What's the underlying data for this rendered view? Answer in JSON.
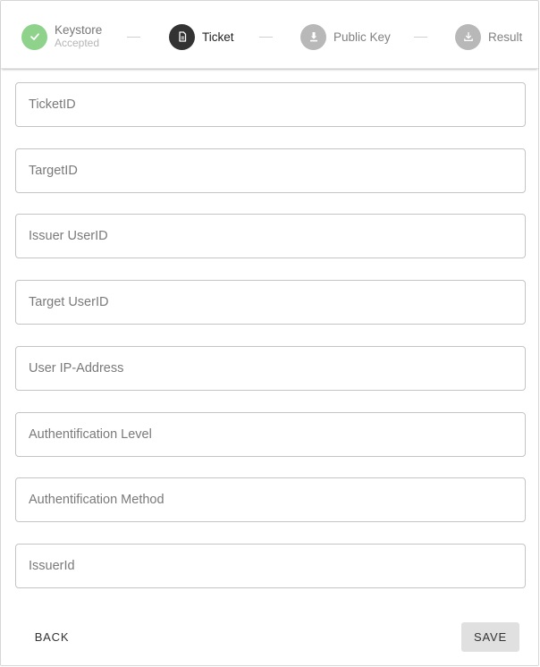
{
  "stepper": {
    "steps": [
      {
        "label": "Keystore",
        "sublabel": "Accepted",
        "icon": "check-icon",
        "state": "completed",
        "color": "#8ed28b"
      },
      {
        "label": "Ticket",
        "icon": "document-icon",
        "state": "active",
        "color": "#333333"
      },
      {
        "label": "Public Key",
        "icon": "key-download-icon",
        "state": "pending",
        "color": "#b8b8b8"
      },
      {
        "label": "Result",
        "icon": "download-icon",
        "state": "pending",
        "color": "#b8b8b8"
      }
    ]
  },
  "form": {
    "fields": [
      {
        "placeholder": "TicketID",
        "value": ""
      },
      {
        "placeholder": "TargetID",
        "value": ""
      },
      {
        "placeholder": "Issuer UserID",
        "value": ""
      },
      {
        "placeholder": "Target UserID",
        "value": ""
      },
      {
        "placeholder": "User IP-Address",
        "value": ""
      },
      {
        "placeholder": "Authentification Level",
        "value": ""
      },
      {
        "placeholder": "Authentification Method",
        "value": ""
      },
      {
        "placeholder": "IssuerId",
        "value": ""
      }
    ]
  },
  "actions": {
    "back_label": "BACK",
    "save_label": "SAVE"
  }
}
